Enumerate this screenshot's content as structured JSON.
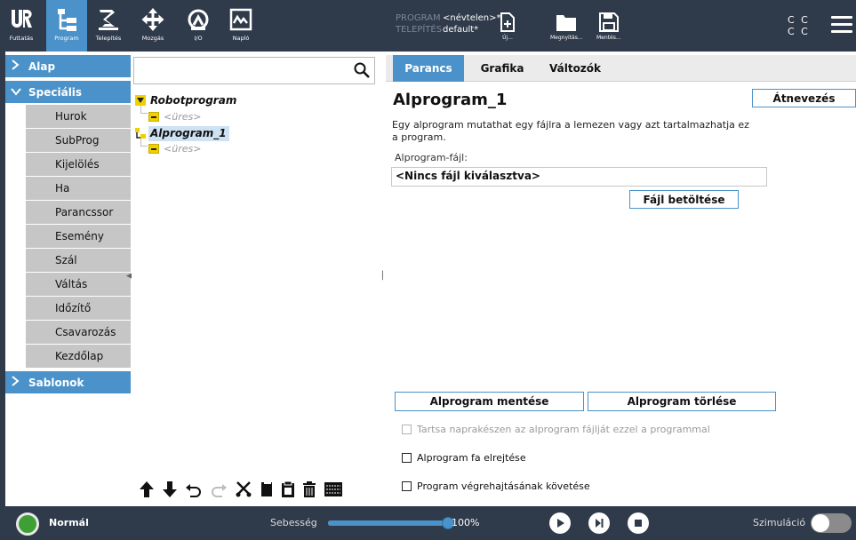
{
  "topbar": {
    "nav": [
      {
        "label": "Futtatás",
        "icon": "ur-logo-icon"
      },
      {
        "label": "Program",
        "icon": "program-tree-icon"
      },
      {
        "label": "Telepítés",
        "icon": "robot-arm-icon"
      },
      {
        "label": "Mozgás",
        "icon": "move-arrows-icon"
      },
      {
        "label": "I/O",
        "icon": "io-icon"
      },
      {
        "label": "Napló",
        "icon": "log-chart-icon"
      }
    ],
    "program_key": "PROGRAM",
    "program_value": "<névtelen>*",
    "install_key": "TELEPÍTÉS",
    "install_value": "default*",
    "file_buttons": [
      {
        "label": "Új...",
        "icon": "new-file-icon"
      },
      {
        "label": "Megnyitás...",
        "icon": "folder-icon"
      },
      {
        "label": "Mentés...",
        "icon": "save-icon"
      }
    ],
    "cc_top": "C C",
    "cc_bottom": "C C",
    "accent": "#4a92c9",
    "bar_color": "#2f3a4a"
  },
  "categories": {
    "basic": "Alap",
    "special": "Speciális",
    "special_items": [
      "Hurok",
      "SubProg",
      "Kijelölés",
      "Ha",
      "Parancssor",
      "Esemény",
      "Szál",
      "Váltás",
      "Időzítő",
      "Csavarozás",
      "Kezdőlap"
    ],
    "templates": "Sablonok"
  },
  "tree": {
    "root": "Robotprogram",
    "empty1": "<üres>",
    "subprog": "Alprogram_1",
    "empty2": "<üres>",
    "tools": [
      "arrow-up-icon",
      "arrow-down-icon",
      "undo-icon",
      "redo-icon",
      "cut-icon",
      "copy-icon",
      "paste-icon",
      "delete-icon",
      "suppress-icon"
    ]
  },
  "right": {
    "tabs": [
      "Parancs",
      "Grafika",
      "Változók"
    ],
    "title": "Alprogram_1",
    "rename_button": "Átnevezés",
    "description": "Egy alprogram mutathat egy fájlra a lemezen vagy azt tartalmazhatja ez a program.",
    "file_label": "Alprogram-fájl:",
    "file_value": "<Nincs fájl kiválasztva>",
    "load_button": "Fájl betöltése",
    "save_button": "Alprogram mentése",
    "delete_button": "Alprogram törlése",
    "chk_keep_updated": "Tartsa naprakészen az alprogram fájlját ezzel a programmal",
    "chk_hide_tree": "Alprogram fa elrejtése",
    "chk_follow": "Program végrehajtásának követése"
  },
  "bottombar": {
    "status": "Normál",
    "status_color": "#3e9f35",
    "speed_label": "Sebesség",
    "speed_value": "100%",
    "speed_fraction": 1.0,
    "simulation_label": "Szimuláció"
  }
}
